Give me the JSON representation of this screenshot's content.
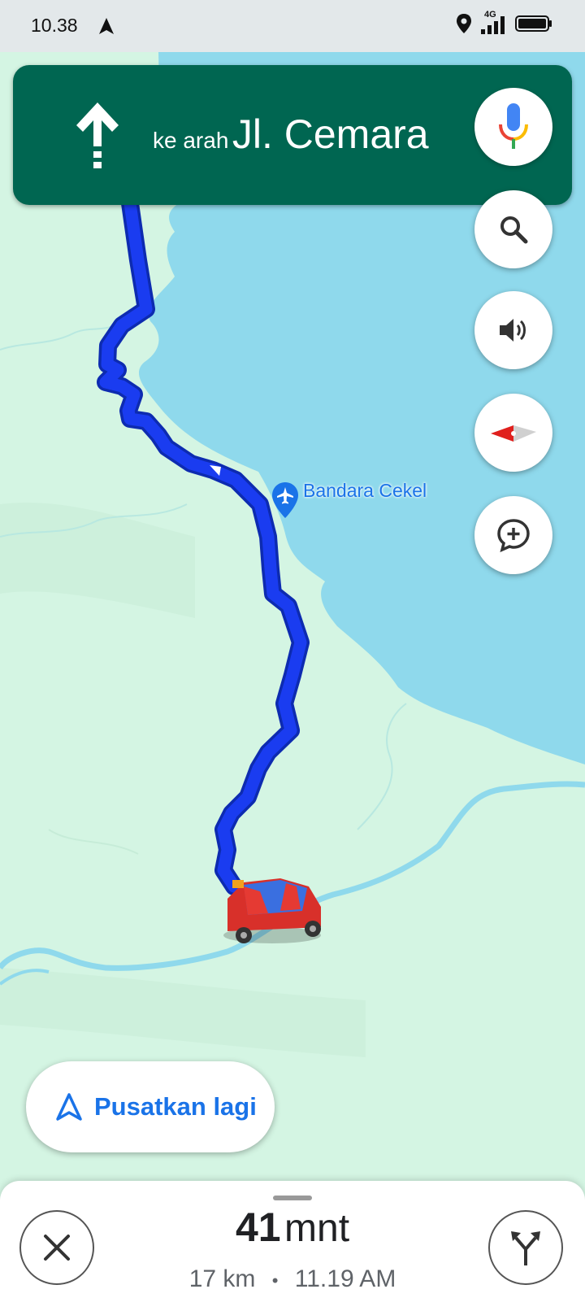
{
  "status_bar": {
    "time": "10.38",
    "network": "4G"
  },
  "nav_banner": {
    "direction": "straight",
    "prefix": "ke arah",
    "street": "Jl. Cemara"
  },
  "map": {
    "place_label": "Bandara Cekel",
    "place_icon": "airplane-icon"
  },
  "map_controls": [
    "search-icon",
    "volume-icon",
    "compass-icon",
    "add-comment-icon"
  ],
  "recenter": {
    "label": "Pusatkan lagi"
  },
  "trip": {
    "eta_minutes": "41",
    "eta_unit": "mnt",
    "distance": "17 km",
    "separator": "•",
    "arrival_time": "11.19 AM"
  },
  "colors": {
    "banner": "#006651",
    "route": "#1a3cf0",
    "water": "#8fd9ec",
    "land": "#d4f5e3",
    "accent": "#1a73e8"
  }
}
